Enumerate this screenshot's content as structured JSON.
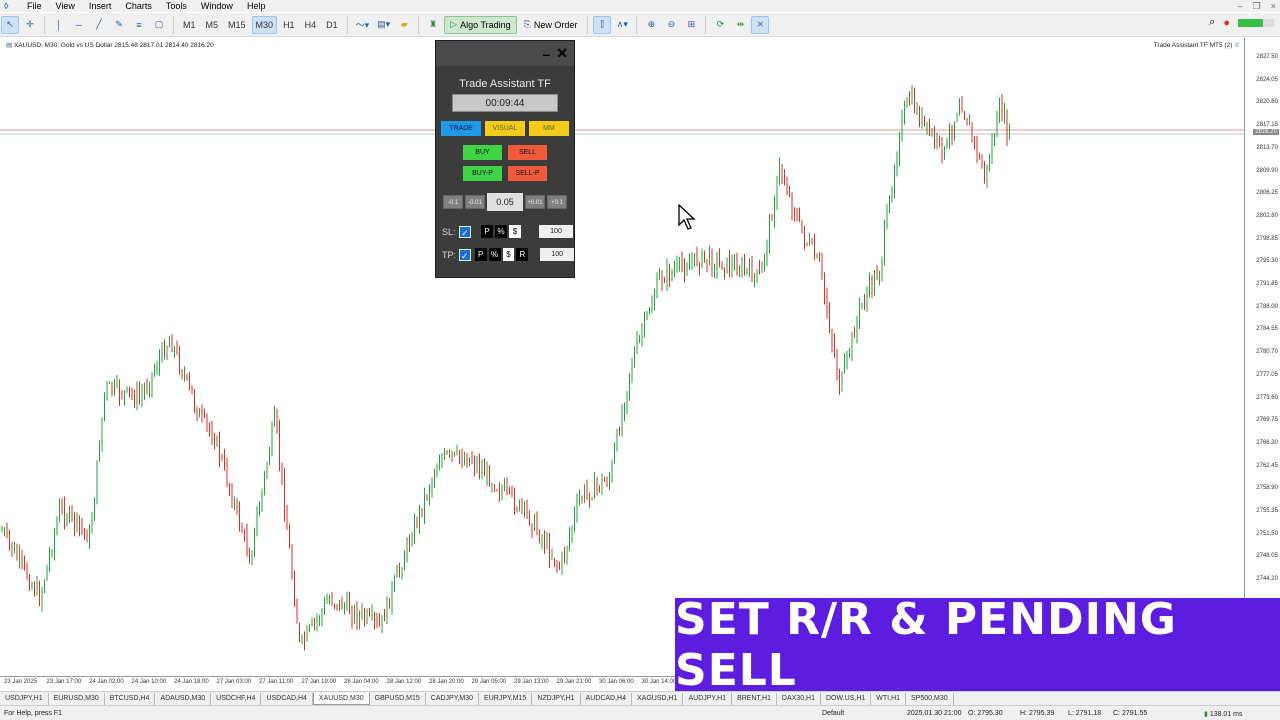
{
  "menu": {
    "items": [
      "File",
      "View",
      "Insert",
      "Charts",
      "Tools",
      "Window",
      "Help"
    ]
  },
  "toolbar": {
    "timeframes": [
      "M1",
      "M5",
      "M15",
      "M30",
      "H1",
      "H4",
      "D1"
    ],
    "active_timeframe": "M30",
    "algo_trading_label": "Algo Trading",
    "new_order_label": "New Order"
  },
  "chart": {
    "title": "XAUUSD, M30:  Gold vs US Dollar  2815.48 2817.01 2814.40 2816.20",
    "ea_label": "Trade Assistant TF MT5 (2)",
    "price_ticks": [
      "2827.50",
      "2824.05",
      "2820.60",
      "2817.15",
      "2813.70",
      "2809.90",
      "2806.25",
      "2802.80",
      "2798.85",
      "2795.30",
      "2791.85",
      "2788.00",
      "2784.55",
      "2780.70",
      "2777.05",
      "2773.60",
      "2769.75",
      "2766.30",
      "2762.45",
      "2758.90",
      "2755.35",
      "2751.50",
      "2748.05",
      "2744.20"
    ],
    "time_ticks": [
      "23 Jan 2025",
      "23 Jan 17:00",
      "24 Jan 02:00",
      "24 Jan 10:00",
      "24 Jan 18:00",
      "27 Jan 03:00",
      "27 Jan 11:00",
      "27 Jan 19:00",
      "28 Jan 04:00",
      "28 Jan 12:00",
      "28 Jan 20:00",
      "29 Jan 05:00",
      "29 Jan 13:00",
      "29 Jan 21:00",
      "30 Jan 06:00",
      "30 Jan 14:00"
    ],
    "current_price_label": "2816.20"
  },
  "panel": {
    "title": "Trade Assistant TF",
    "timer": "00:09:44",
    "tabs": [
      "TRADE",
      "VISUAL",
      "MM"
    ],
    "buy_label": "BUY",
    "sell_label": "SELL",
    "buy_pending_label": "BUY-P",
    "sell_pending_label": "SELL-P",
    "lot_dec_big": "-0.1",
    "lot_dec_small": "-0.01",
    "lot_value": "0.05",
    "lot_inc_small": "+0.01",
    "lot_inc_big": "+0.1",
    "sl_label": "SL:",
    "sl_modes": [
      "P",
      "%",
      "$"
    ],
    "sl_value": "100",
    "tp_label": "TP:",
    "tp_modes": [
      "P",
      "%",
      "$",
      "R"
    ],
    "tp_value": "100"
  },
  "banner": {
    "text": "SET R/R & PENDING SELL"
  },
  "symbol_tabs": [
    "USDJPY,H1",
    "EURUSD,M30",
    "BTCUSD,H4",
    "ADAUSD,M30",
    "USDCHF,H4",
    "USDCAD,H4",
    "XAUUSD,M30",
    "GBPUSD,M15",
    "CADJPY,M30",
    "EURJPY,M15",
    "NZDJPY,H1",
    "AUDCAD,H4",
    "XAGUSD,H1",
    "AUDJPY,H1",
    "BRENT,H1",
    "DAX30,H1",
    "DOW.US,H1",
    "WTI,H1",
    "SP500,M30"
  ],
  "active_symbol_tab": "XAUUSD,M30",
  "status": {
    "help": "For Help, press F1",
    "profile": "Default",
    "datetime": "2025.01.30 21:00",
    "open": "O: 2795.30",
    "high": "H: 2795.39",
    "low": "L: 2791.18",
    "close": "C: 2791.55",
    "traffic": "138.01 ms"
  },
  "colors": {
    "bull": "#26a03a",
    "bear": "#d93025",
    "banner": "#5c1de0",
    "panel_bg": "#3c3c3c"
  }
}
